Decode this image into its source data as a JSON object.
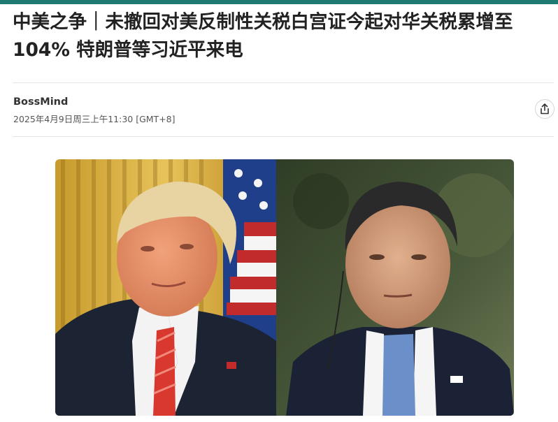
{
  "article": {
    "headline": "中美之争｜未撤回对美反制性关税白宫证今起对华关税累增至104% 特朗普等习近平来电",
    "author": "BossMind",
    "timestamp": "2025年4月9日周三上午11:30 [GMT+8]"
  },
  "icons": {
    "share": "share-icon"
  },
  "colors": {
    "accent_line": "#1f7a73"
  }
}
